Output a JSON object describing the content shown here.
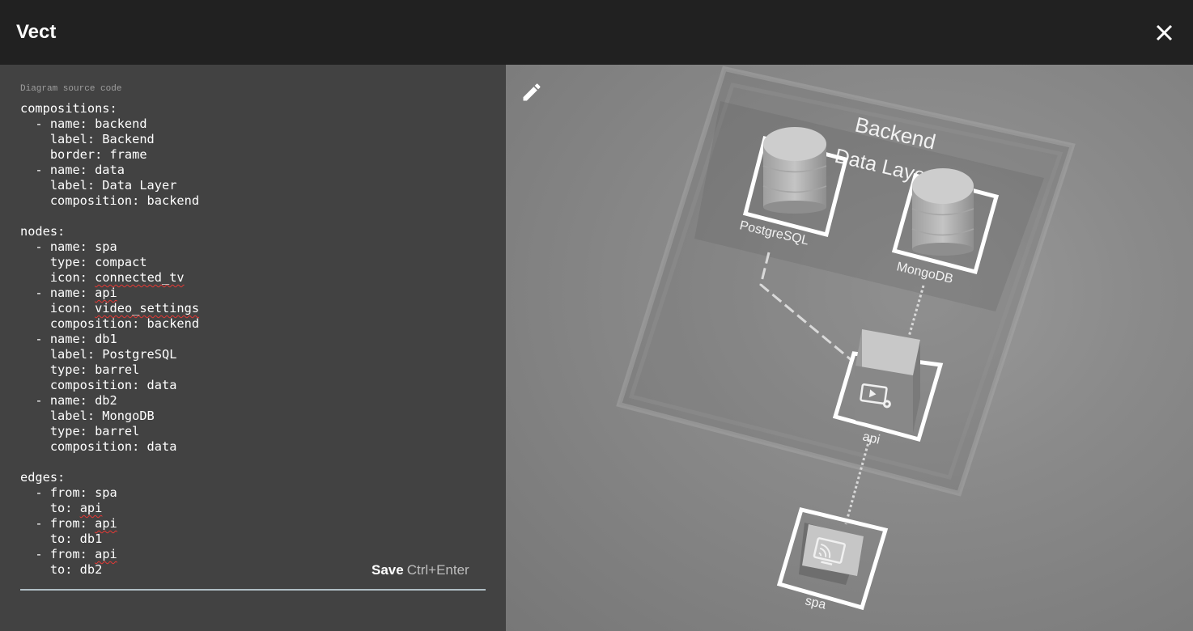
{
  "app": {
    "title": "Vect"
  },
  "editor": {
    "field_label": "Diagram source code",
    "lines": [
      "compositions:",
      "  - name: backend",
      "    label: Backend",
      "    border: frame",
      "  - name: data",
      "    label: Data Layer",
      "    composition: backend",
      "",
      "nodes:",
      "  - name: spa",
      "    type: compact",
      "    icon: connected_tv",
      "  - name: api",
      "    icon: video_settings",
      "    composition: backend",
      "  - name: db1",
      "    label: PostgreSQL",
      "    type: barrel",
      "    composition: data",
      "  - name: db2",
      "    label: MongoDB",
      "    type: barrel",
      "    composition: data",
      "",
      "edges:",
      "  - from: spa",
      "    to: api",
      "  - from: api",
      "    to: db1",
      "  - from: api",
      "    to: db2"
    ],
    "save_label": "Save",
    "save_shortcut": "Ctrl+Enter"
  },
  "diagram": {
    "compositions": [
      {
        "name": "backend",
        "label": "Backend"
      },
      {
        "name": "data",
        "label": "Data Layer"
      }
    ],
    "nodes": [
      {
        "name": "db1",
        "label": "PostgreSQL",
        "icon": "database-barrel"
      },
      {
        "name": "db2",
        "label": "MongoDB",
        "icon": "database-barrel"
      },
      {
        "name": "api",
        "label": "api",
        "icon": "video-settings-icon"
      },
      {
        "name": "spa",
        "label": "spa",
        "icon": "connected-tv-icon"
      }
    ]
  },
  "icons": {
    "close": "close-icon",
    "edit": "pencil-icon"
  },
  "colors": {
    "header_bg": "#212121",
    "editor_bg": "#424242",
    "canvas_bg": "#8a8a8a",
    "accent": "#b0bec5",
    "spellcheck": "#e53935"
  }
}
